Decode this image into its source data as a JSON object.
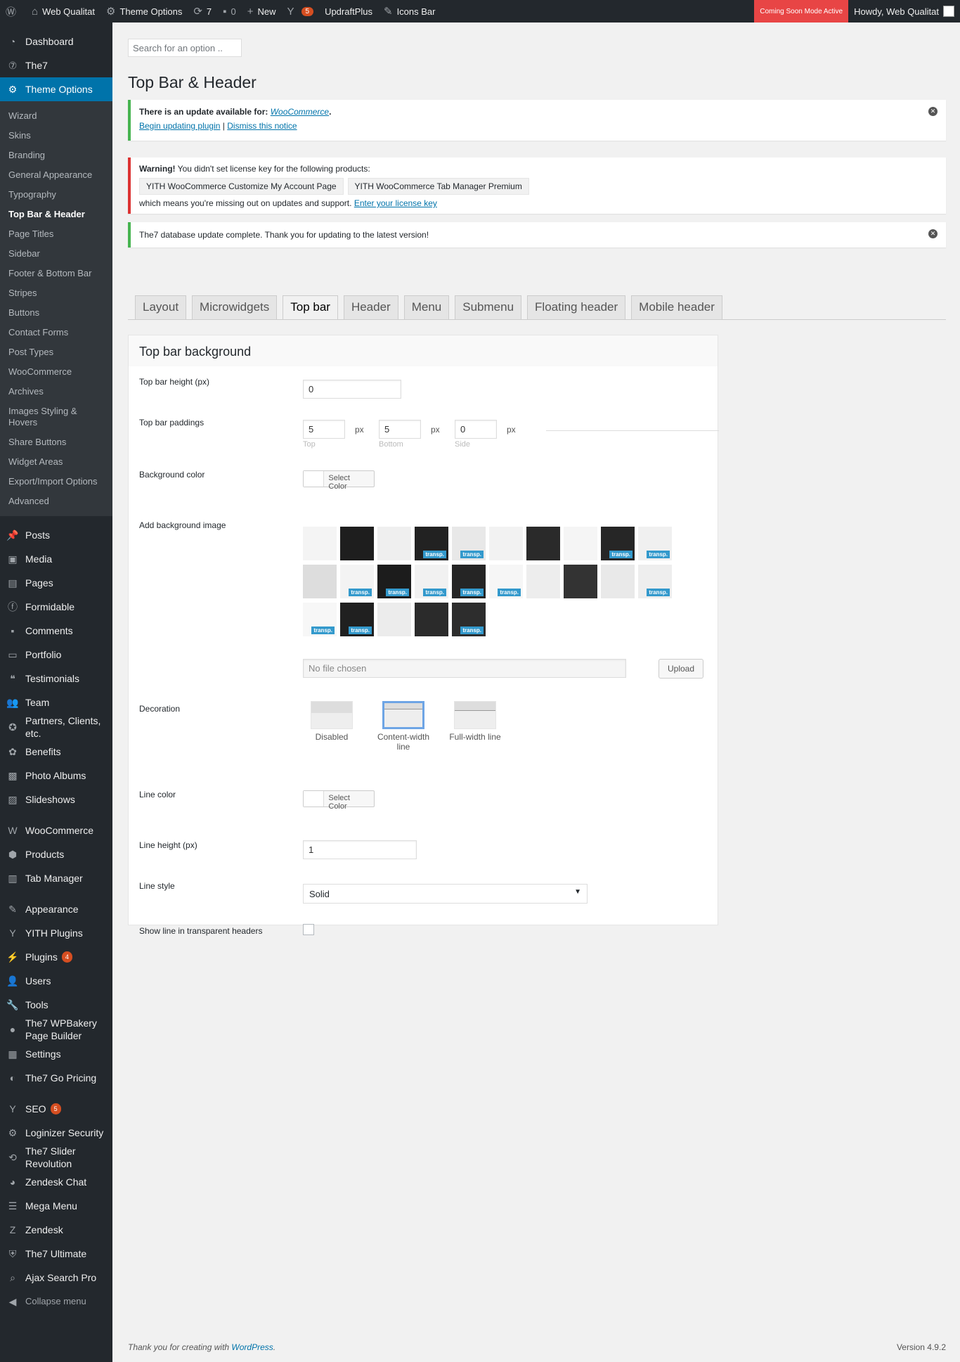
{
  "adminbar": {
    "site": "Web Qualitat",
    "theme_options": "Theme Options",
    "updates": "7",
    "comments": "0",
    "new": "New",
    "yoast_count": "5",
    "updraft": "UpdraftPlus",
    "icons_bar": "Icons Bar",
    "coming_soon": "Coming Soon Mode Active",
    "howdy": "Howdy, Web Qualitat"
  },
  "menu": {
    "top": [
      {
        "label": "Dashboard",
        "icon": "dashboard-icon"
      },
      {
        "label": "The7",
        "icon": "the7-icon"
      },
      {
        "label": "Theme Options",
        "icon": "gear-icon"
      }
    ],
    "submenu": [
      "Wizard",
      "Skins",
      "Branding",
      "General Appearance",
      "Typography",
      "Top Bar & Header",
      "Page Titles",
      "Sidebar",
      "Footer & Bottom Bar",
      "Stripes",
      "Buttons",
      "Contact Forms",
      "Post Types",
      "WooCommerce",
      "Archives",
      "Images Styling & Hovers",
      "Share Buttons",
      "Widget Areas",
      "Export/Import Options",
      "Advanced"
    ],
    "group2": [
      "Posts",
      "Media",
      "Pages",
      "Formidable",
      "Comments",
      "Portfolio",
      "Testimonials",
      "Team",
      "Partners, Clients, etc.",
      "Benefits",
      "Photo Albums",
      "Slideshows"
    ],
    "group3": [
      "WooCommerce",
      "Products",
      "Tab Manager"
    ],
    "group4": [
      "Appearance",
      "YITH Plugins",
      "Plugins",
      "Users",
      "Tools",
      "The7 WPBakery Page Builder",
      "Settings",
      "The7 Go Pricing"
    ],
    "plugins_count": "4",
    "group5": [
      "SEO",
      "Loginizer Security",
      "The7 Slider Revolution",
      "Zendesk Chat",
      "Mega Menu",
      "Zendesk",
      "The7 Ultimate",
      "Ajax Search Pro"
    ],
    "seo_count": "5",
    "collapse": "Collapse menu"
  },
  "search_placeholder": "Search for an option ..",
  "page_title": "Top Bar & Header",
  "notice1": {
    "text": "There is an update available for: ",
    "link": "WooCommerce",
    "after": ".",
    "begin": "Begin updating plugin",
    "sep": "|",
    "dismiss": "Dismiss this notice"
  },
  "notice2": {
    "warning": "Warning!",
    "text": " You didn't set license key for the following products:",
    "products": [
      "YITH WooCommerce Customize My Account Page",
      "YITH WooCommerce Tab Manager Premium"
    ],
    "tail": "which means you're missing out on updates and support. ",
    "link": "Enter your license key"
  },
  "notice3": {
    "text": "The7 database update complete. Thank you for updating to the latest version!"
  },
  "tabs": [
    "Layout",
    "Microwidgets",
    "Top bar",
    "Header",
    "Menu",
    "Submenu",
    "Floating header",
    "Mobile header"
  ],
  "section_title": "Top bar background",
  "fields": {
    "height_label": "Top bar height (px)",
    "height_value": "0",
    "paddings_label": "Top bar paddings",
    "pad_top": "5",
    "pad_bottom": "5",
    "pad_side": "0",
    "px": "px",
    "top": "Top",
    "bottom": "Bottom",
    "side": "Side",
    "bg_color_label": "Background color",
    "select_color": "Select Color",
    "bg_image_label": "Add background image",
    "transp": "transp.",
    "no_file": "No file chosen",
    "upload": "Upload",
    "decoration_label": "Decoration",
    "deco_disabled": "Disabled",
    "deco_content": "Content-width line",
    "deco_full": "Full-width line",
    "line_color_label": "Line color",
    "line_height_label": "Line height (px)",
    "line_height_value": "1",
    "line_style_label": "Line style",
    "line_style_value": "Solid",
    "show_line_label": "Show line in transparent headers"
  },
  "footer": {
    "text": "Thank you for creating with ",
    "link": "WordPress",
    "after": ".",
    "version": "Version 4.9.2"
  }
}
